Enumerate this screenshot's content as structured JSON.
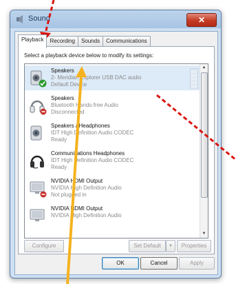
{
  "window": {
    "title": "Sound",
    "close_glyph": "✕"
  },
  "tabs": [
    {
      "label": "Playback",
      "active": true
    },
    {
      "label": "Recording",
      "active": false
    },
    {
      "label": "Sounds",
      "active": false
    },
    {
      "label": "Communications",
      "active": false
    }
  ],
  "instruction": "Select a playback device below to modify its settings:",
  "devices": [
    {
      "name": "Speakers",
      "desc": "2- Meridian Explorer USB DAC audio",
      "status": "Default Device",
      "icon": "speaker-icon",
      "badge": "default-check",
      "selected": true
    },
    {
      "name": "Speakers",
      "desc": "Bluetooth Hands-free Audio",
      "status": "Disconnected",
      "icon": "headphones-icon",
      "badge": "disconnected",
      "selected": false
    },
    {
      "name": "Speakers / Headphones",
      "desc": "IDT High Definition Audio CODEC",
      "status": "Ready",
      "icon": "speaker-icon",
      "badge": "none",
      "selected": false
    },
    {
      "name": "Communications Headphones",
      "desc": "IDT High Definition Audio CODEC",
      "status": "Ready",
      "icon": "headset-icon",
      "badge": "none",
      "selected": false
    },
    {
      "name": "NVIDIA HDMI Output",
      "desc": "NVIDIA High Definition Audio",
      "status": "Not plugged in",
      "icon": "monitor-speaker-icon",
      "badge": "disconnected",
      "selected": false
    },
    {
      "name": "NVIDIA HDMI Output",
      "desc": "NVIDIA High Definition Audio",
      "status": "",
      "icon": "monitor-speaker-icon",
      "badge": "none",
      "selected": false
    }
  ],
  "buttons": {
    "configure": "Configure",
    "set_default": "Set Default",
    "properties": "Properties",
    "ok": "OK",
    "cancel": "Cancel",
    "apply": "Apply"
  },
  "annotation_colors": {
    "arrow_red": "#d9140f",
    "arrow_yellow": "#f5b21f"
  }
}
